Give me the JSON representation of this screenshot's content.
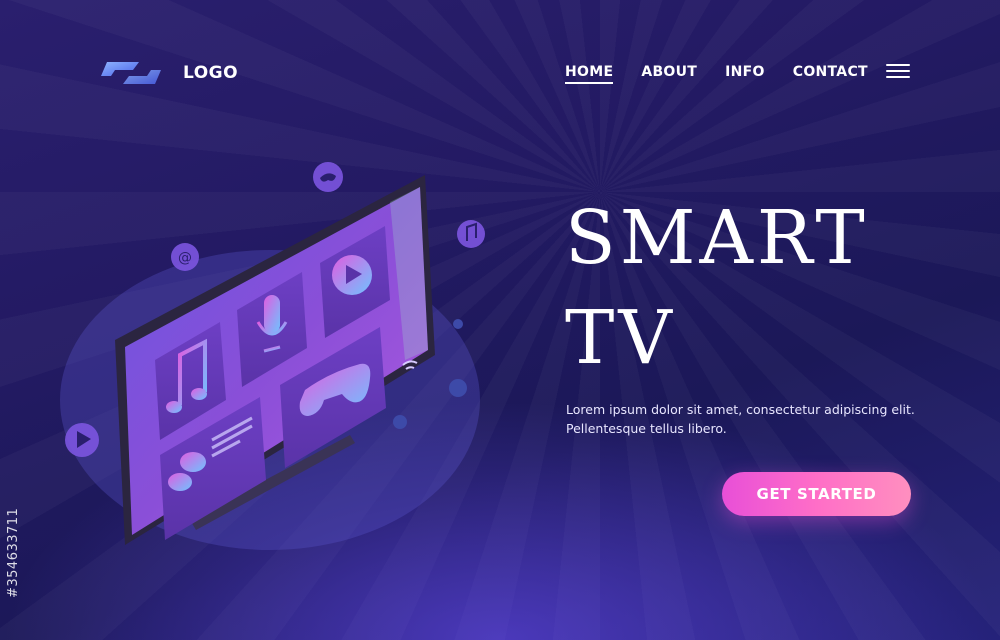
{
  "brand": {
    "logo_text": "LOGO"
  },
  "nav": {
    "items": [
      {
        "label": "HOME",
        "active": true
      },
      {
        "label": "ABOUT",
        "active": false
      },
      {
        "label": "INFO",
        "active": false
      },
      {
        "label": "CONTACT",
        "active": false
      }
    ]
  },
  "hero": {
    "title_line1": "SMART",
    "title_line2": "TV",
    "description": "Lorem ipsum dolor sit amet, consectetur adipiscing elit. Pellentesque tellus libero.",
    "cta_label": "GET STARTED"
  },
  "watermark": {
    "stock_id": "#354633711"
  },
  "colors": {
    "background": "#231a63",
    "accent_pink": "#e84fd8",
    "tile_purple": "#7b4fd6",
    "icon_blue": "#6fa8ff"
  },
  "icons": [
    "hamburger-menu-icon",
    "music-note-icon",
    "microphone-icon",
    "play-icon",
    "gamepad-icon",
    "chat-bubbles-icon",
    "at-sign-icon",
    "wifi-icon",
    "gear-icon"
  ]
}
